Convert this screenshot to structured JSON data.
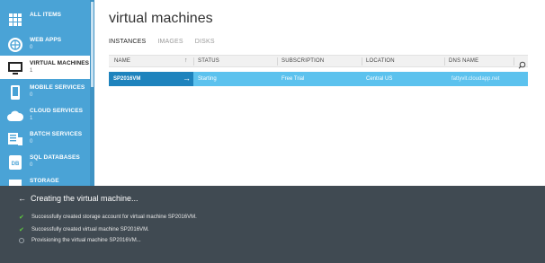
{
  "sidebar": {
    "items": [
      {
        "label": "ALL ITEMS",
        "count": "",
        "icon": "grid-icon"
      },
      {
        "label": "WEB APPS",
        "count": "0",
        "icon": "globe-icon"
      },
      {
        "label": "VIRTUAL MACHINES",
        "count": "1",
        "icon": "monitor-icon"
      },
      {
        "label": "MOBILE SERVICES",
        "count": "0",
        "icon": "phone-icon"
      },
      {
        "label": "CLOUD SERVICES",
        "count": "1",
        "icon": "cloud-icon"
      },
      {
        "label": "BATCH SERVICES",
        "count": "0",
        "icon": "batch-icon"
      },
      {
        "label": "SQL DATABASES",
        "count": "0",
        "icon": "database-icon"
      },
      {
        "label": "STORAGE",
        "count": "",
        "icon": "storage-icon"
      }
    ]
  },
  "main": {
    "title": "virtual machines",
    "tabs": [
      "INSTANCES",
      "IMAGES",
      "DISKS"
    ],
    "columns": [
      "NAME",
      "STATUS",
      "SUBSCRIPTION",
      "LOCATION",
      "DNS NAME"
    ],
    "rows": [
      {
        "name": "SP2016VM",
        "status": "Starting",
        "subscription": "Free Trial",
        "location": "Central US",
        "dns": "fattyvit.cloudapp.net"
      }
    ]
  },
  "notification": {
    "title": "Creating the virtual machine...",
    "messages": [
      {
        "text": "Successfully created storage account for virtual machine SP2016VM.",
        "state": "done"
      },
      {
        "text": "Successfully created virtual machine SP2016VM.",
        "state": "done"
      },
      {
        "text": "Provisioning the virtual machine SP2016VM...",
        "state": "pending"
      }
    ]
  },
  "colors": {
    "sidebar": "#4aa3d6",
    "row_selected": "#5cc2ee",
    "row_name": "#1e83bd",
    "panel": "#404a52",
    "check": "#5fcf3d"
  }
}
